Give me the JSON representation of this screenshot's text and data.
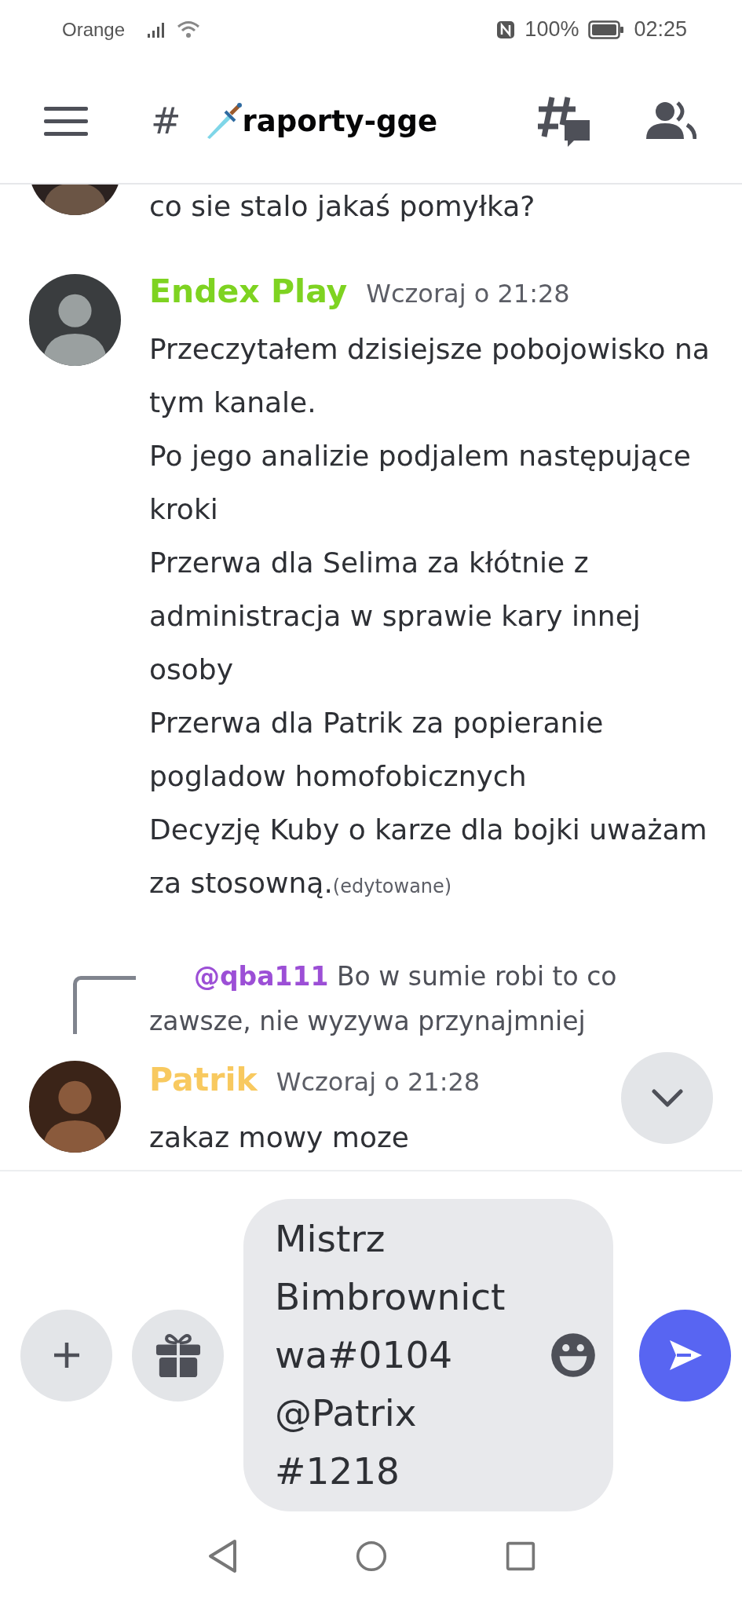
{
  "status_bar": {
    "carrier": "Orange",
    "battery": "100%",
    "time": "02:25"
  },
  "header": {
    "channel_prefix": "#",
    "channel_name": "raporty-gge"
  },
  "messages": [
    {
      "kind": "continuation",
      "lines": [
        "co sie stalo jakaś pomyłka?"
      ]
    },
    {
      "kind": "full",
      "author": "Endex Play",
      "color": "#7ed321",
      "time": "Wczoraj o 21:28",
      "lines": [
        "Przeczytałem dzisiejsze pobojowisko na tym kanale.",
        "Po jego analizie podjalem następujące kroki",
        "Przerwa dla Selima za kłótnie z administracja w sprawie kary innej osoby",
        "Przerwa dla Patrik za popieranie pogladow homofobicznych",
        "Decyzję Kuby o karze dla bojki uważam za stosowną."
      ],
      "edited": "(edytowane)"
    },
    {
      "kind": "reply",
      "reply": {
        "mention": "@qba111",
        "text": "Bo w sumie robi to co zawsze, nie wyzywa przynajmniej"
      },
      "author": "Patrik",
      "color": "#f8c95f",
      "time": "Wczoraj o 21:28",
      "lines": [
        "zakaz mowy moze"
      ]
    }
  ],
  "composer": {
    "value": "Mistrz Bimbrownictwa#0104 @Patrix #1218"
  }
}
